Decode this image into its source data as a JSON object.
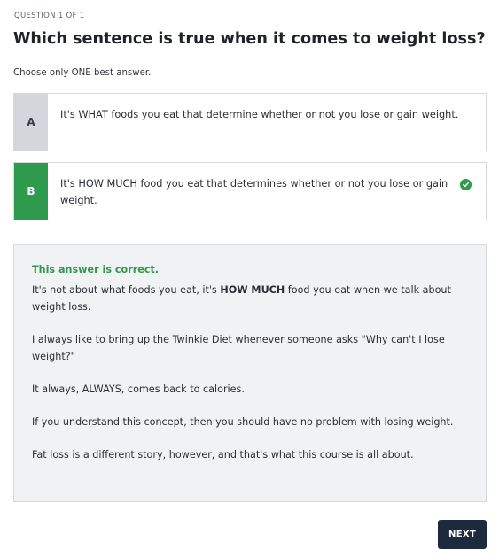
{
  "question": {
    "counter": "QUESTION 1 OF 1",
    "title": "Which sentence is true when it comes to weight loss?",
    "instruction": "Choose only ONE best answer."
  },
  "options": [
    {
      "letter": "A",
      "text": "It's WHAT foods you eat that determine whether or not you lose or gain weight.",
      "selected": false
    },
    {
      "letter": "B",
      "text": "It's HOW MUCH food you eat that determines whether or not you lose or gain weight.",
      "selected": true,
      "status_icon": "check-circle-icon"
    }
  ],
  "feedback": {
    "status": "This answer is correct.",
    "para1_prefix": "It's not about what foods you eat, it's ",
    "para1_bold": "HOW MUCH",
    "para1_suffix": " food you eat when we talk about weight loss.",
    "para2": "I always like to bring up the Twinkie Diet whenever someone asks \"Why can't I lose weight?\"",
    "para3": "It always, ALWAYS, comes back to calories.",
    "para4": "If you understand this concept, then you should have no problem with losing weight.",
    "para5": "Fat loss is a different story, however, and that's what this course is all about."
  },
  "next_label": "NEXT",
  "colors": {
    "correct_green": "#2e9a4d",
    "unselected_letter_bg": "#d4d6dc",
    "feedback_bg": "#f1f2f4",
    "next_button_bg": "#1d2a3d"
  }
}
